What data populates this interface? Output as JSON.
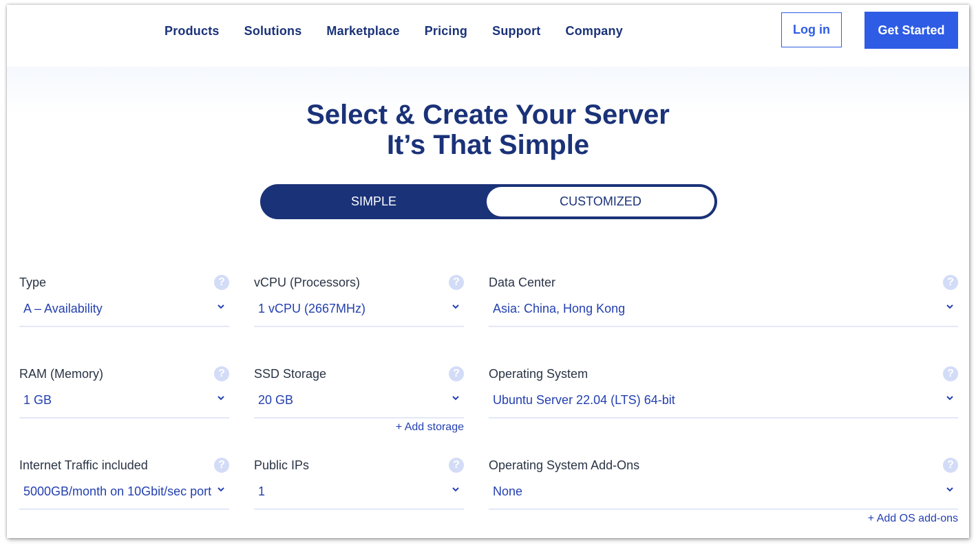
{
  "nav": {
    "links": [
      "Products",
      "Solutions",
      "Marketplace",
      "Pricing",
      "Support",
      "Company"
    ],
    "login_label": "Log in",
    "get_started_label": "Get Started"
  },
  "hero": {
    "title_line1": "Select & Create Your Server",
    "title_line2": "It’s That Simple",
    "toggle": {
      "simple_label": "SIMPLE",
      "customized_label": "CUSTOMIZED",
      "selected": "SIMPLE"
    }
  },
  "form": {
    "type": {
      "label": "Type",
      "value": "A – Availability"
    },
    "vcpu": {
      "label": "vCPU (Processors)",
      "value": "1 vCPU (2667MHz)"
    },
    "datacenter": {
      "label": "Data Center",
      "value": "Asia: China, Hong Kong"
    },
    "ram": {
      "label": "RAM (Memory)",
      "value": "1 GB"
    },
    "ssd": {
      "label": "SSD Storage",
      "value": "20 GB",
      "add_label": "+ Add storage"
    },
    "os": {
      "label": "Operating System",
      "value": "Ubuntu Server 22.04 (LTS) 64-bit"
    },
    "traffic": {
      "label": "Internet Traffic included",
      "value": "5000GB/month on 10Gbit/sec port"
    },
    "ips": {
      "label": "Public IPs",
      "value": "1"
    },
    "os_addons": {
      "label": "Operating System Add-Ons",
      "value": "None",
      "add_label": "+ Add OS add-ons"
    }
  },
  "icons": {
    "help": "?"
  },
  "colors": {
    "navy": "#1a3278",
    "accent": "#2f5ce5",
    "select_text": "#2440b0",
    "help_bg": "#d3dcf7"
  }
}
